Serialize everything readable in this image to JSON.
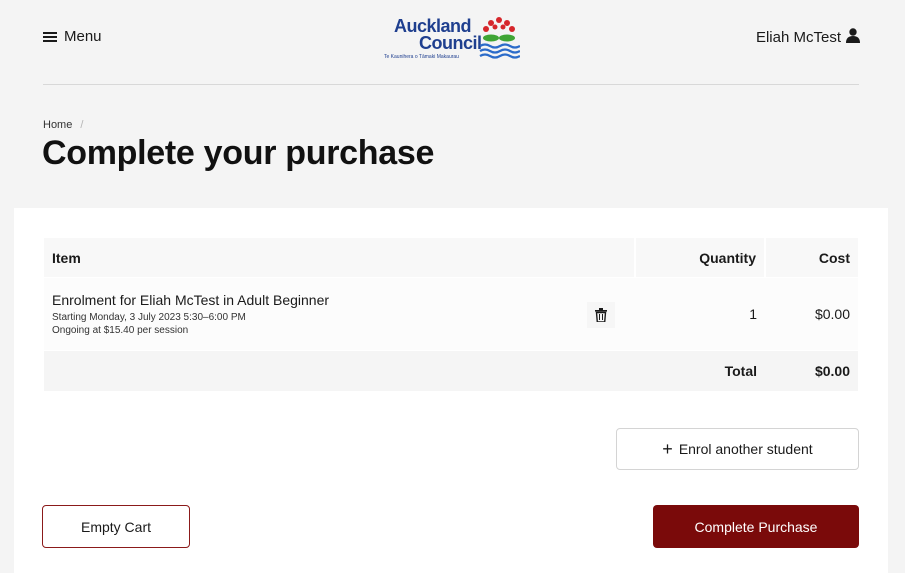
{
  "header": {
    "menu_label": "Menu",
    "logo": {
      "line1": "Auckland",
      "line2": "Council",
      "tagline": "Te Kaunihera o Tāmaki Makaurau"
    },
    "user_name": "Eliah McTest",
    "icons": {
      "menu": "hamburger-icon",
      "user": "user-icon"
    }
  },
  "breadcrumb": {
    "home": "Home",
    "separator": "/"
  },
  "page": {
    "title": "Complete your purchase"
  },
  "cart": {
    "columns": {
      "item": "Item",
      "quantity": "Quantity",
      "cost": "Cost"
    },
    "items": [
      {
        "title": "Enrolment for Eliah McTest in Adult Beginner",
        "line1": "Starting Monday, 3 July 2023 5:30–6:00 PM",
        "line2": "Ongoing at $15.40 per session",
        "quantity": "1",
        "cost": "$0.00",
        "icon": "trash-icon"
      }
    ],
    "total_label": "Total",
    "total_value": "$0.00"
  },
  "actions": {
    "enrol_another": "Enrol another student",
    "empty_cart": "Empty Cart",
    "complete_purchase": "Complete Purchase"
  },
  "colors": {
    "primary": "#7a0a0a",
    "brand_blue": "#1f3f8f",
    "border_accent": "#8b1a1a"
  }
}
